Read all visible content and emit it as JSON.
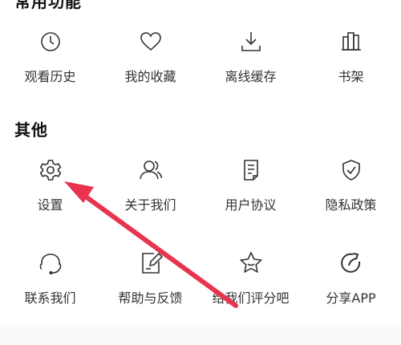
{
  "sections": {
    "common": {
      "title": "常用功能"
    },
    "other": {
      "title": "其他"
    }
  },
  "common_items": [
    {
      "label": "观看历史",
      "icon": "clock-icon"
    },
    {
      "label": "我的收藏",
      "icon": "heart-icon"
    },
    {
      "label": "离线缓存",
      "icon": "download-icon"
    },
    {
      "label": "书架",
      "icon": "bookshelf-icon"
    }
  ],
  "other_items": [
    {
      "label": "设置",
      "icon": "gear-icon"
    },
    {
      "label": "关于我们",
      "icon": "people-icon"
    },
    {
      "label": "用户协议",
      "icon": "document-icon"
    },
    {
      "label": "隐私政策",
      "icon": "shield-check-icon"
    },
    {
      "label": "联系我们",
      "icon": "headset-icon"
    },
    {
      "label": "帮助与反馈",
      "icon": "edit-note-icon"
    },
    {
      "label": "给我们评分吧",
      "icon": "star-face-icon"
    },
    {
      "label": "分享APP",
      "icon": "share-circle-icon"
    }
  ],
  "colors": {
    "icon_stroke": "#333333",
    "annotation_arrow": "#e8344e"
  }
}
